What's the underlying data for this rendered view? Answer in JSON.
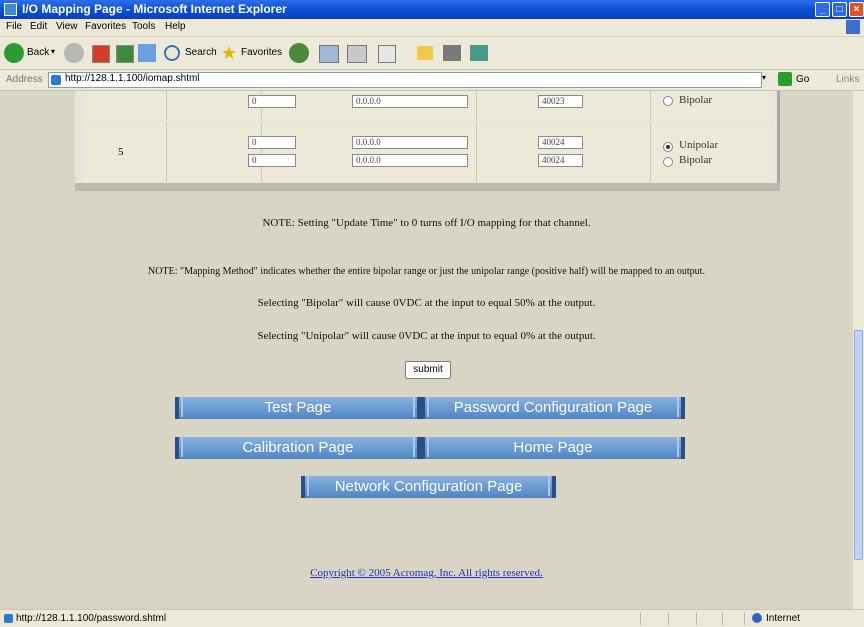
{
  "window": {
    "title": "I/O Mapping Page - Microsoft Internet Explorer"
  },
  "menu": [
    "File",
    "Edit",
    "View",
    "Favorites",
    "Tools",
    "Help"
  ],
  "toolbar": {
    "back": "Back",
    "search": "Search",
    "favorites": "Favorites"
  },
  "address": {
    "label": "Address",
    "url": "http://128.1.1.100/iomap.shtml",
    "go": "Go",
    "links": "Links"
  },
  "table": {
    "partial_row": {
      "update_time": "0",
      "ip": "0.0.0.0",
      "register": "40023",
      "option": "Bipolar"
    },
    "row5": {
      "channel": "5",
      "update_times": [
        "0",
        "0"
      ],
      "ips": [
        "0.0.0.0",
        "0.0.0.0"
      ],
      "registers": [
        "40024",
        "40024"
      ],
      "options": [
        "Unipolar",
        "Bipolar"
      ],
      "selected": "Unipolar"
    }
  },
  "notes": {
    "update_time": "NOTE: Setting \"Update Time\" to 0 turns off I/O mapping for that channel.",
    "mapping_method": "NOTE: \"Mapping Method\" indicates whether the entire bipolar range or just the unipolar range (positive half) will be mapped to an output.",
    "bipolar": "Selecting \"Bipolar\" will cause 0VDC at the input to equal 50% at the output.",
    "unipolar": "Selecting \"Unipolar\" will cause 0VDC at the input to equal 0% at the output."
  },
  "submit_label": "submit",
  "nav": {
    "test": "Test Page",
    "password": "Password Configuration Page",
    "calibration": "Calibration Page",
    "home": "Home Page",
    "network": "Network Configuration Page"
  },
  "copyright": "Copyright © 2005 Acromag, Inc. All rights reserved.",
  "status": {
    "url": "http://128.1.1.100/password.shtml",
    "zone": "Internet"
  },
  "colors": {
    "titlebar": "#0a4fd8",
    "nav_button": "#4f84c2",
    "link": "#2233bb"
  }
}
